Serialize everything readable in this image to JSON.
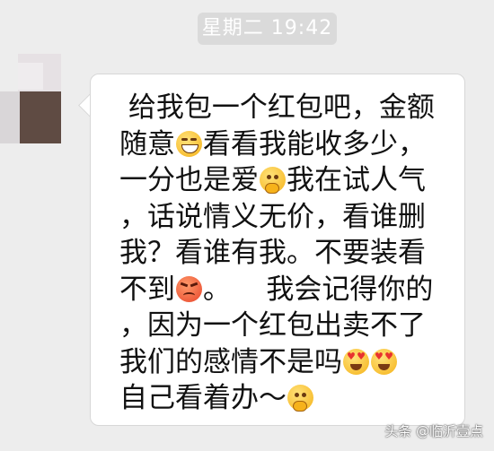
{
  "timestamp": "星期二 19:42",
  "message": {
    "lines": [
      [
        {
          "t": " 给我包一个红包吧，金额"
        }
      ],
      [
        {
          "t": "随意"
        },
        {
          "emoji": "grinning-face"
        },
        {
          "t": "看看我能收多少，"
        }
      ],
      [
        {
          "t": "一分也是爱"
        },
        {
          "emoji": "thinking-face"
        },
        {
          "t": "我在试人气"
        }
      ],
      [
        {
          "t": "，话说情义无价，看谁删"
        }
      ],
      [
        {
          "t": "我？看谁有我。不要装看"
        }
      ],
      [
        {
          "t": "不到"
        },
        {
          "emoji": "angry-face"
        },
        {
          "t": "。    我会记得你的"
        }
      ],
      [
        {
          "t": "，因为一个红包出卖不了"
        }
      ],
      [
        {
          "t": "我们的感情不是吗"
        },
        {
          "emoji": "heart-eyes-face"
        },
        {
          "emoji": "heart-eyes-face"
        }
      ],
      [
        {
          "t": "自己看着办～"
        },
        {
          "emoji": "thinking-face"
        }
      ]
    ]
  },
  "watermark": "头条 @临沂壹点",
  "colors": {
    "background": "#ededed",
    "bubble": "#ffffff",
    "timestamp_bg": "#dadada"
  }
}
